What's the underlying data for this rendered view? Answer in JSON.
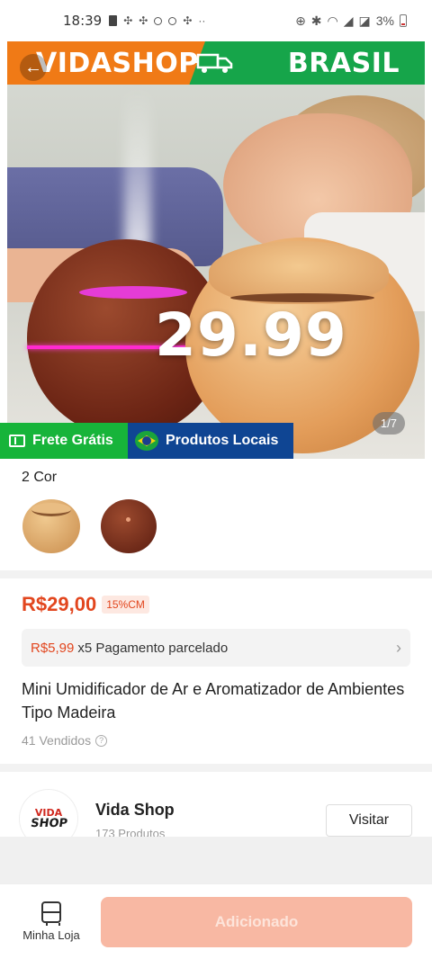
{
  "status_bar": {
    "time": "18:39",
    "battery": "3%"
  },
  "hero": {
    "banner_left": "VIDASHOP",
    "banner_right": "BRASIL",
    "price_overlay": "29.99",
    "image_counter": "1/7",
    "badge_free_shipping": "Frete Grátis",
    "badge_local_products": "Produtos Locais"
  },
  "variants": {
    "label": "2 Cor",
    "options": [
      "light-wood",
      "dark-wood"
    ]
  },
  "product": {
    "price": "R$29,00",
    "discount": "15%CM",
    "installment_amount": "R$5,99",
    "installment_text": "x5 Pagamento parcelado",
    "title": "Mini Umidificador de Ar e Aromatizador de Ambientes Tipo Madeira",
    "sold": "41 Vendidos"
  },
  "shop": {
    "logo_top": "VIDA",
    "logo_bottom": "SHOP",
    "name": "Vida Shop",
    "products": "173 Produtos",
    "visit_label": "Visitar"
  },
  "bottom_bar": {
    "store_label": "Minha Loja",
    "add_label": "Adicionado"
  },
  "colors": {
    "accent": "#e2461e",
    "banner_orange": "#f07a16",
    "banner_green": "#16a54a",
    "chip_green": "#17b43a",
    "chip_blue": "#0f4593",
    "add_button": "#f8b8a3"
  }
}
